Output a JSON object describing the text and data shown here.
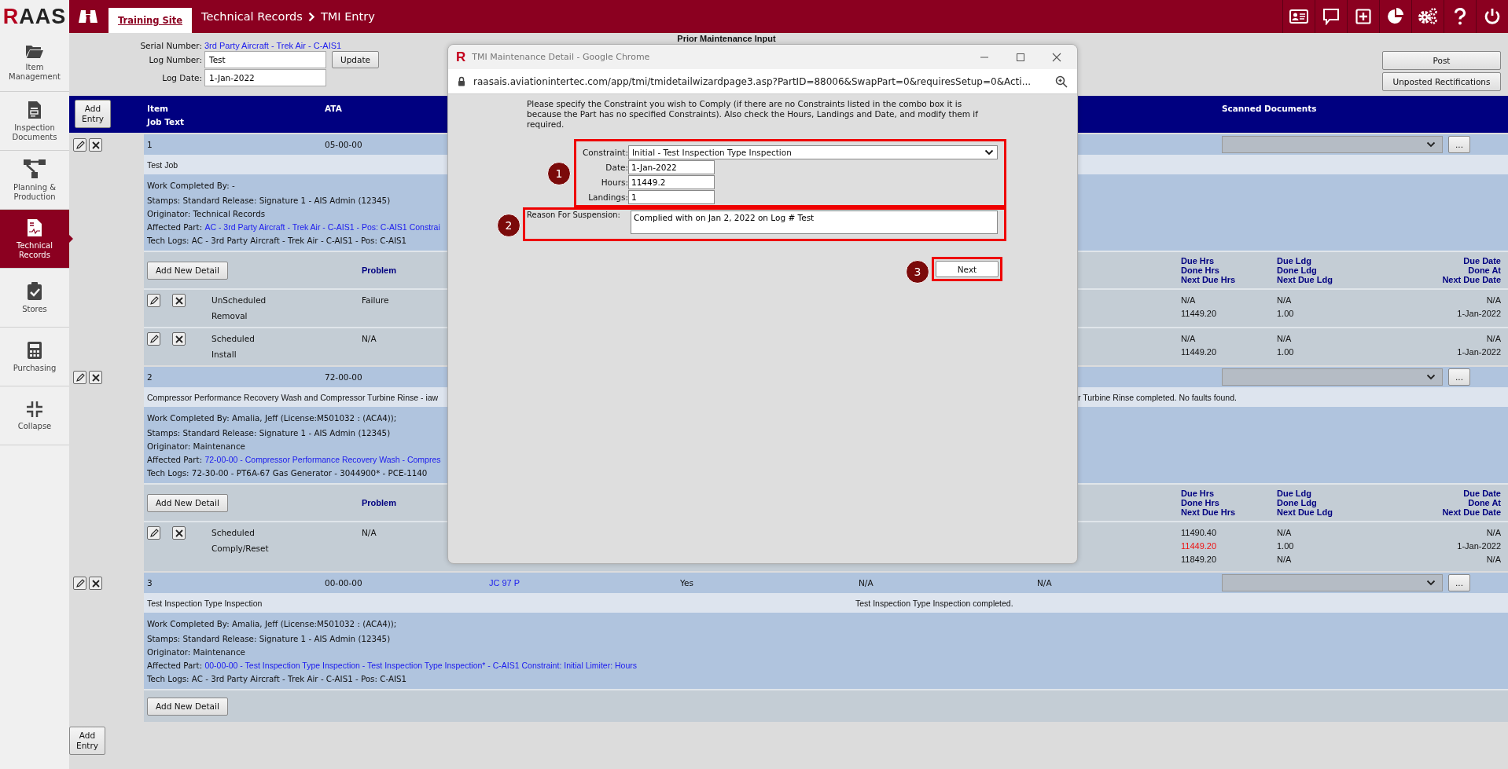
{
  "topbar": {
    "logo_accent": "R",
    "logo_rest": "AAS",
    "site_tab": "Training Site",
    "breadcrumb": [
      "Technical Records",
      "TMI Entry"
    ]
  },
  "sidebar": {
    "items": [
      {
        "label": "Item Management",
        "selected": false
      },
      {
        "label": "Inspection Documents",
        "selected": false
      },
      {
        "label": "Planning & Production",
        "selected": false
      },
      {
        "label": "Technical Records",
        "selected": true
      },
      {
        "label": "Stores",
        "selected": false
      },
      {
        "label": "Purchasing",
        "selected": false
      },
      {
        "label": "Collapse",
        "selected": false
      }
    ]
  },
  "header": {
    "serial_label": "Serial Number:",
    "serial_value": "3rd Party Aircraft - Trek Air - C-AIS1",
    "log_number_label": "Log Number:",
    "log_number": "Test",
    "update_button": "Update",
    "log_date_label": "Log Date:",
    "log_date": "1-Jan-2022",
    "section_title": "Prior Maintenance Input",
    "buttons": [
      "Post",
      "Unposted Rectifications"
    ]
  },
  "table": {
    "add_entry": "Add Entry",
    "columns": {
      "item": "Item",
      "job_text": "Job Text",
      "ata": "ATA",
      "scanned_documents": "Scanned Documents"
    },
    "entries": [
      {
        "item": "1",
        "ata": "05-00-00",
        "browse_button": "...",
        "job_text": "Test Job",
        "lines": [
          {
            "text": "Work Completed By: -"
          },
          {
            "text": "Stamps: Standard Release: Signature 1 - AIS Admin (12345)"
          },
          {
            "text": "Originator: Technical Records"
          },
          {
            "text": "Affected Part:",
            "link": "AC - 3rd Party Aircraft - Trek Air - C-AIS1 - Pos: C-AIS1 Constrai"
          },
          {
            "text": "Tech Logs: AC - 3rd Party Aircraft - Trek Air - C-AIS1 - Pos: C-AIS1"
          }
        ],
        "add_detail": "Add New Detail",
        "detail_headers": {
          "problem": "Problem",
          "hrs": [
            "Due Hrs",
            "Done Hrs",
            "Next Due Hrs"
          ],
          "ldg": [
            "Due Ldg",
            "Done Ldg",
            "Next Due Ldg"
          ],
          "date": [
            "Due Date",
            "Done At",
            "Next Due Date"
          ]
        },
        "details": [
          {
            "type": [
              "UnScheduled",
              "Removal"
            ],
            "problem": "Failure",
            "hrs": [
              "N/A",
              "11449.20"
            ],
            "done_hrs_overdue": false,
            "ldg": [
              "N/A",
              "1.00"
            ],
            "date": [
              "N/A",
              "1-Jan-2022"
            ]
          },
          {
            "type": [
              "Scheduled",
              "Install"
            ],
            "problem": "N/A",
            "hrs": [
              "N/A",
              "11449.20"
            ],
            "done_hrs_overdue": false,
            "ldg": [
              "N/A",
              "1.00"
            ],
            "date": [
              "N/A",
              "1-Jan-2022"
            ]
          }
        ]
      },
      {
        "item": "2",
        "ata": "72-00-00",
        "browse_button": "...",
        "job_text": "Compressor Performance Recovery Wash and Compressor Turbine Rinse - iaw",
        "job_result_tail": "r Turbine Rinse completed. No faults found.",
        "lines": [
          {
            "text": "Work Completed By: Amalia, Jeff (License:M501032 : (ACA4));"
          },
          {
            "text": "Stamps: Standard Release: Signature 1 - AIS Admin (12345)"
          },
          {
            "text": "Originator: Maintenance"
          },
          {
            "text": "Affected Part:",
            "link": "72-00-00 - Compressor Performance Recovery Wash - Compres"
          },
          {
            "text": "Tech Logs: 72-30-00 - PT6A-67 Gas Generator - 3044900* - PCE-1140"
          }
        ],
        "add_detail": "Add New Detail",
        "detail_headers": {
          "problem": "Problem",
          "hrs": [
            "Due Hrs",
            "Done Hrs",
            "Next Due Hrs"
          ],
          "ldg": [
            "Due Ldg",
            "Done Ldg",
            "Next Due Ldg"
          ],
          "date": [
            "Due Date",
            "Done At",
            "Next Due Date"
          ]
        },
        "details": [
          {
            "type": [
              "Scheduled",
              "Comply/Reset"
            ],
            "problem": "N/A",
            "hrs": [
              "11490.40",
              "11449.20",
              "11849.20"
            ],
            "done_hrs_overdue": true,
            "ldg": [
              "N/A",
              "1.00",
              "N/A"
            ],
            "date": [
              "N/A",
              "1-Jan-2022",
              "N/A"
            ]
          }
        ]
      },
      {
        "item": "3",
        "ata": "00-00-00",
        "column_3": "JC 97 P",
        "column_4": "Yes",
        "column_5": "N/A",
        "column_6": "N/A",
        "browse_button": "...",
        "job_text": "Test Inspection Type Inspection",
        "job_result": "Test Inspection Type Inspection completed.",
        "lines": [
          {
            "text": "Work Completed By: Amalia, Jeff (License:M501032 : (ACA4));"
          },
          {
            "text": "Stamps: Standard Release: Signature 1 - AIS Admin (12345)"
          },
          {
            "text": "Originator: Maintenance"
          },
          {
            "text": "Affected Part:",
            "link": "00-00-00 - Test Inspection Type Inspection - Test Inspection Type Inspection* - C-AIS1 Constraint: Initial Limiter: Hours"
          },
          {
            "text": "Tech Logs: AC - 3rd Party Aircraft - Trek Air - C-AIS1 - Pos: C-AIS1"
          }
        ],
        "add_detail": "Add New Detail"
      }
    ],
    "bottom_add_entry": "Add Entry"
  },
  "modal": {
    "favicon": "R",
    "title": "TMI Maintenance Detail - Google Chrome",
    "url": "raasais.aviationintertec.com/app/tmi/tmidetailwizardpage3.asp?PartID=88006&SwapPart=0&requiresSetup=0&Acti...",
    "instructions": "Please specify the Constraint you wish to Comply (if there are no Constraints listed in the combo box it is because the Part has no specified Constraints). Also check the Hours, Landings and Date, and modify them if required.",
    "callouts": [
      "1",
      "2",
      "3"
    ],
    "fields": [
      {
        "kind": "select",
        "label": "Constraint:",
        "value": "Initial - Test Inspection Type Inspection"
      },
      {
        "kind": "input",
        "label": "Date:",
        "value": "1-Jan-2022"
      },
      {
        "kind": "input",
        "label": "Hours:",
        "value": "11449.2"
      },
      {
        "kind": "input",
        "label": "Landings:",
        "value": "1"
      }
    ],
    "reason_label": "Reason For Suspension:",
    "reason": "Complied with on Jan 2, 2022 on Log # Test",
    "next_button": "Next"
  }
}
